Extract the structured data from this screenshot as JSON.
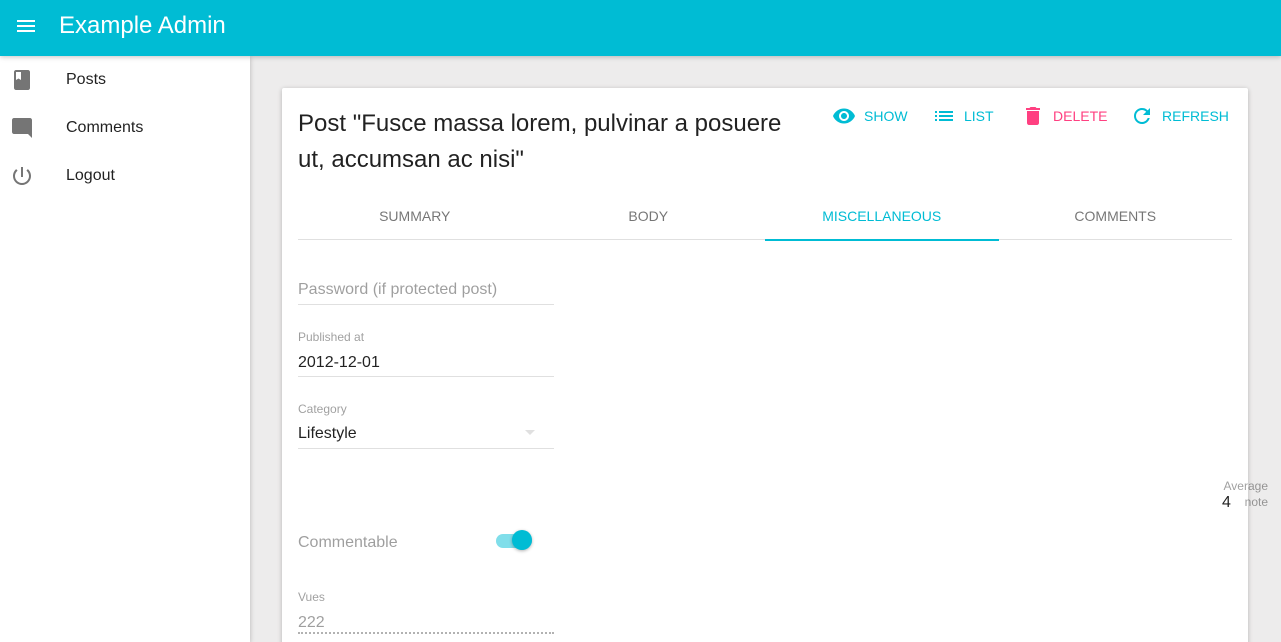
{
  "app": {
    "title": "Example Admin"
  },
  "sidebar": {
    "items": [
      {
        "label": "Posts",
        "icon": "book-icon"
      },
      {
        "label": "Comments",
        "icon": "comment-icon"
      },
      {
        "label": "Logout",
        "icon": "power-icon"
      }
    ]
  },
  "card": {
    "title": "Post \"Fusce massa lorem, pulvinar a posuere ut, accumsan ac nisi\"",
    "actions": [
      {
        "label": "SHOW",
        "icon": "eye-icon"
      },
      {
        "label": "LIST",
        "icon": "list-icon"
      },
      {
        "label": "DELETE",
        "icon": "trash-icon"
      },
      {
        "label": "REFRESH",
        "icon": "refresh-icon"
      }
    ],
    "tabs": [
      "SUMMARY",
      "BODY",
      "MISCELLANEOUS",
      "COMMENTS"
    ],
    "active_tab": "MISCELLANEOUS"
  },
  "form": {
    "password": {
      "placeholder": "Password (if protected post)",
      "value": ""
    },
    "published_at": {
      "label": "Published at",
      "value": "2012-12-01"
    },
    "category": {
      "label": "Category",
      "value": "Lifestyle"
    },
    "average_note": {
      "label": "Average note",
      "value": "4"
    },
    "commentable": {
      "label": "Commentable",
      "checked": true
    },
    "views": {
      "label": "Vues",
      "value": "222"
    }
  },
  "colors": {
    "primary": "#00bcd4",
    "accent": "#ff4081",
    "background": "#edecec"
  }
}
